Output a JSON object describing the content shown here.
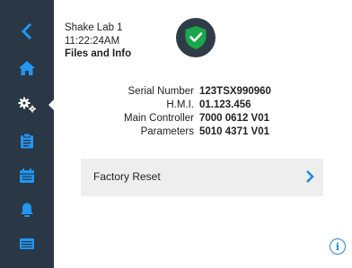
{
  "header": {
    "device_name": "Shake Lab 1",
    "time": "11:22:24AM",
    "page_title": "Files and Info"
  },
  "status": {
    "icon": "check-icon",
    "color": "#1aa64b",
    "state": "ok"
  },
  "device_info": [
    {
      "label": "Serial Number",
      "value": "123TSX990960"
    },
    {
      "label": "H.M.I.",
      "value": "01.123.456"
    },
    {
      "label": "Main Controller",
      "value": "7000 0612 V01"
    },
    {
      "label": "Parameters",
      "value": "5010 4371 V01"
    }
  ],
  "actions": {
    "factory_reset_label": "Factory Reset"
  },
  "sidebar": {
    "items": [
      {
        "icon": "back-chevron-icon"
      },
      {
        "icon": "home-icon"
      },
      {
        "icon": "settings-gears-icon",
        "active": true
      },
      {
        "icon": "clipboard-icon"
      },
      {
        "icon": "calendar-icon"
      },
      {
        "icon": "bell-icon"
      },
      {
        "icon": "monitor-icon"
      }
    ]
  },
  "colors": {
    "sidebar_bg": "#2a3744",
    "accent": "#1e88e5",
    "badge_bg": "#2f3c48"
  }
}
